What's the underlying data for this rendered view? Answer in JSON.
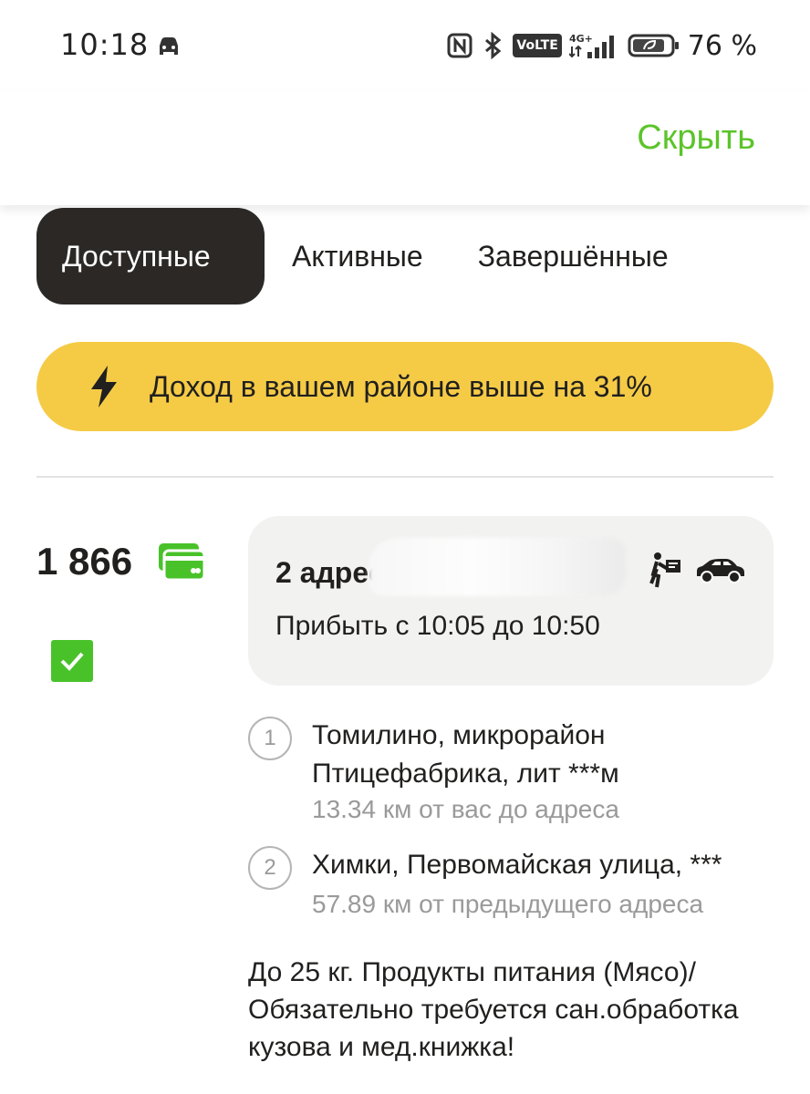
{
  "status_bar": {
    "time": "10:18",
    "network": "4G+",
    "volte": "VoLTE",
    "battery": "76 %"
  },
  "header": {
    "hide_label": "Скрыть"
  },
  "tabs": [
    {
      "label": "Доступные",
      "active": true
    },
    {
      "label": "Активные",
      "active": false
    },
    {
      "label": "Завершённые",
      "active": false
    }
  ],
  "banner": {
    "text": "Доход в вашем районе выше на 31%",
    "color": "#f5cb46"
  },
  "order": {
    "price": "1 866",
    "payment_icon": "card-icon",
    "checked": true,
    "address_count": "2 адреса",
    "arrival": "Прибыть с 10:05 до 10:50",
    "stops": [
      {
        "number": "1",
        "address": "Томилино, микрорайон Птицефабрика, лит ***м",
        "distance": "13.34 км от вас до адреса"
      },
      {
        "number": "2",
        "address": "Химки, Первомайская улица, ***",
        "distance": "57.89 км от предыдущего адреса"
      }
    ],
    "note": "До 25 кг. Продукты питания (Мясо)/ Обязательно требуется сан.обработка кузова и мед.книжка!"
  },
  "colors": {
    "accent_green": "#5bc42a",
    "check_green": "#49c22a",
    "tab_active_bg": "#2b2826",
    "card_bg": "#f2f2f1"
  }
}
